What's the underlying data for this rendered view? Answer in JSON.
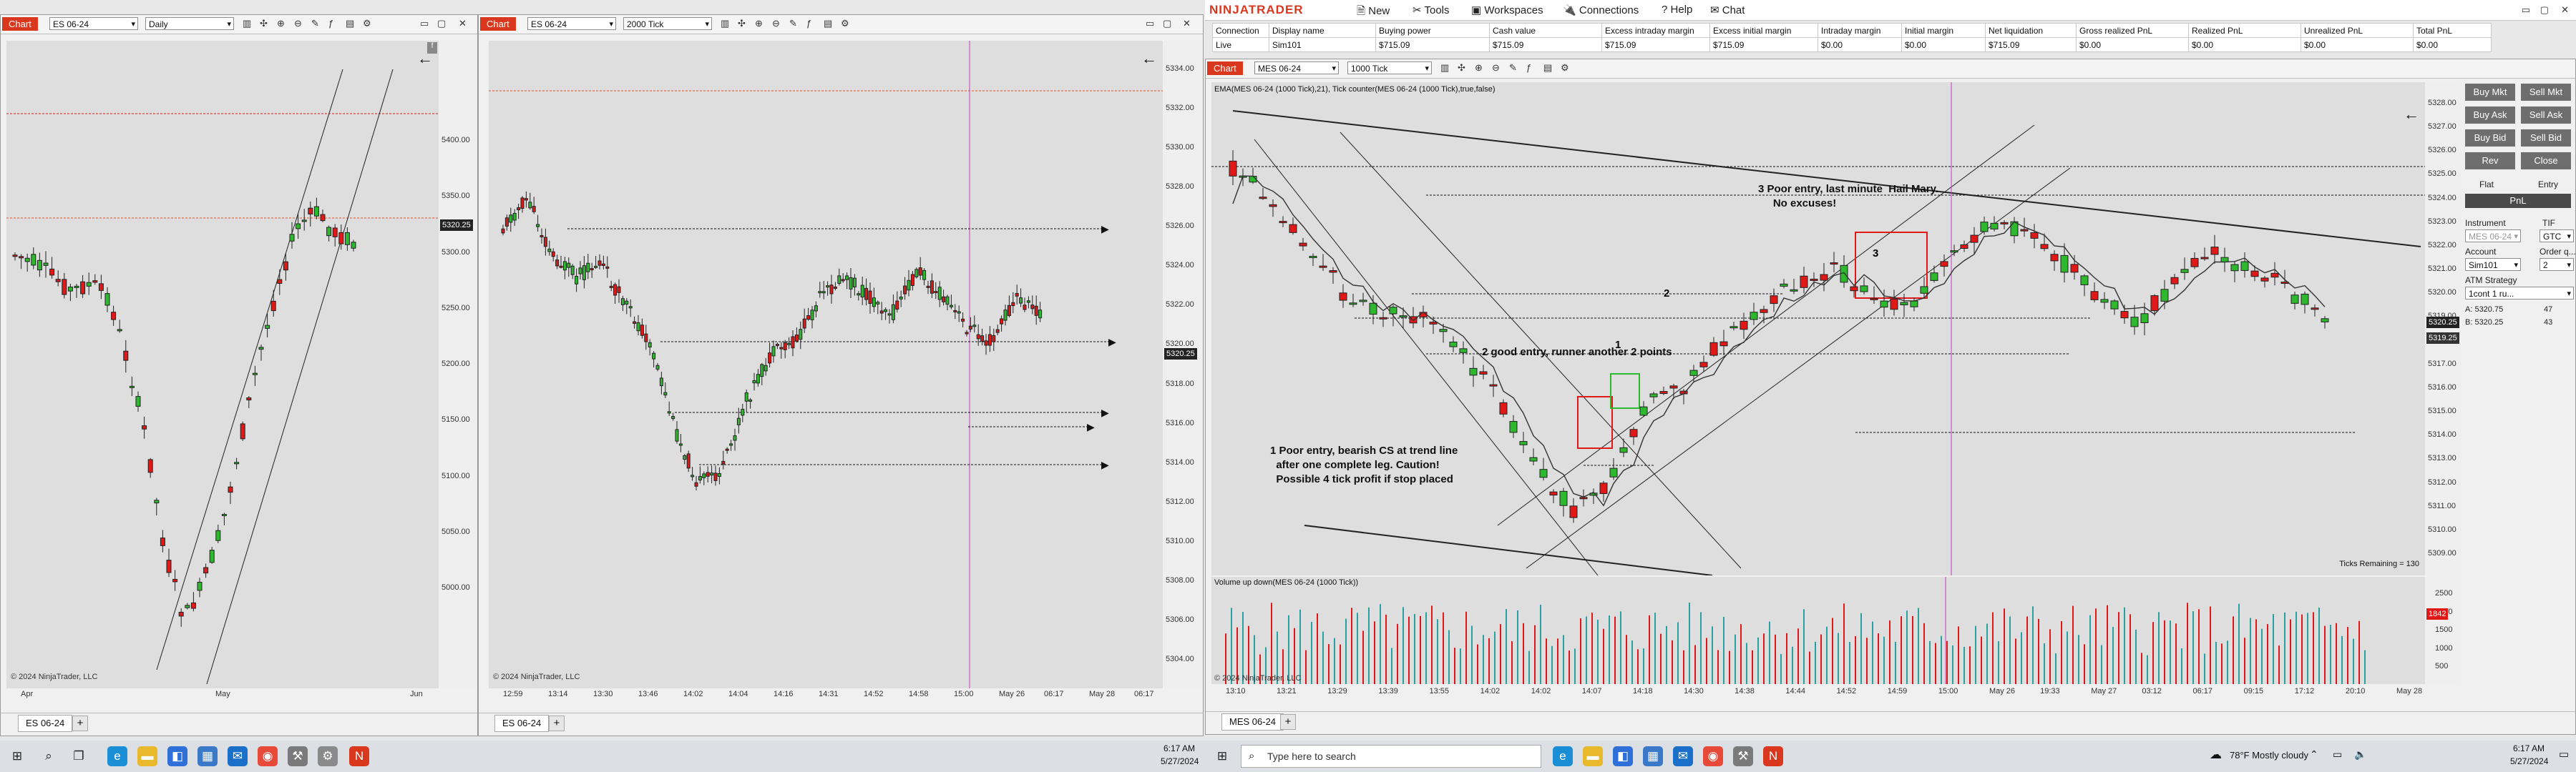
{
  "chart1": {
    "tag": "Chart",
    "instrument": "ES 06-24",
    "interval": "Daily",
    "price_labels": [
      "5400.00",
      "5350.00",
      "5300.00",
      "5250.00",
      "5200.00",
      "5150.00",
      "5100.00",
      "5050.00",
      "5000.00"
    ],
    "current_price": "5320.25",
    "x_labels": [
      "Apr",
      "May",
      "Jun"
    ],
    "copyright": "© 2024 NinjaTrader, LLC",
    "tab": "ES 06-24"
  },
  "chart2": {
    "tag": "Chart",
    "instrument": "ES 06-24",
    "interval": "2000 Tick",
    "price_labels": [
      "5334.00",
      "5332.00",
      "5330.00",
      "5328.00",
      "5326.00",
      "5324.00",
      "5322.00",
      "5320.00",
      "5318.00",
      "5316.00",
      "5314.00",
      "5312.00",
      "5310.00",
      "5308.00",
      "5306.00",
      "5304.00"
    ],
    "current_price": "5320.25",
    "x_labels": [
      "12:59",
      "13:14",
      "13:30",
      "13:46",
      "14:02",
      "14:04",
      "14:16",
      "14:31",
      "14:52",
      "14:58",
      "15:00",
      "May 26",
      "06:17",
      "May 28",
      "06:17"
    ],
    "copyright": "© 2024 NinjaTrader, LLC",
    "tab": "ES 06-24"
  },
  "nt": {
    "logo": "NINJATRADER",
    "menu": [
      "New",
      "Tools",
      "Workspaces",
      "Connections",
      "Help",
      "Chat"
    ],
    "accounts_header": [
      "Connection",
      "Display name",
      "Buying power",
      "Cash value",
      "Excess intraday margin",
      "Excess initial margin",
      "Intraday margin",
      "Initial margin",
      "Net liquidation",
      "Gross realized PnL",
      "Realized PnL",
      "Unrealized PnL",
      "Total PnL"
    ],
    "accounts_row": [
      "Live",
      "Sim101",
      "$715.09",
      "$715.09",
      "$715.09",
      "$715.09",
      "$0.00",
      "$0.00",
      "$715.09",
      "$0.00",
      "$0.00",
      "$0.00",
      "$0.00"
    ]
  },
  "chart3": {
    "tag": "Chart",
    "instrument": "MES 06-24",
    "interval": "1000 Tick",
    "indicator_label": "EMA(MES 06-24 (1000 Tick),21), Tick counter(MES 06-24 (1000 Tick),true,false)",
    "price_labels": [
      "5328.00",
      "5327.00",
      "5326.00",
      "5325.00",
      "5324.00",
      "5323.00",
      "5322.00",
      "5321.00",
      "5320.00",
      "5319.00",
      "5318.00",
      "5317.00",
      "5316.00",
      "5315.00",
      "5314.00",
      "5313.00",
      "5312.00",
      "5311.00",
      "5310.00",
      "5309.00"
    ],
    "current_price": "5320.25",
    "price_tag2": "5319.25",
    "ticks_remaining": "Ticks Remaining = 130",
    "volume_label": "Volume up down(MES 06-24 (1000 Tick))",
    "volume_labels": [
      "2500",
      "2000",
      "1500",
      "1000",
      "500"
    ],
    "volume_current": "1842",
    "x_labels": [
      "13:10",
      "13:21",
      "13:29",
      "13:39",
      "13:55",
      "14:02",
      "14:02",
      "14:07",
      "14:18",
      "14:30",
      "14:38",
      "14:44",
      "14:52",
      "14:59",
      "15:00",
      "May 26",
      "19:33",
      "May 27",
      "03:12",
      "06:17",
      "09:15",
      "17:12",
      "20:10",
      "May 28"
    ],
    "copyright": "© 2024 NinjaTrader, LLC",
    "tab": "MES 06-24",
    "note1": "1 Poor entry, bearish CS at trend line\n  after one complete leg. Caution!\n  Possible 4 tick profit if stop placed",
    "note2": "2 good entry, runner another 2 points",
    "note3": "3 Poor entry, last minute  Hail Mary.\n     No excuses!",
    "box_labels": [
      "1",
      "2",
      "3"
    ]
  },
  "order_panel": {
    "buttons": [
      "Buy Mkt",
      "Sell Mkt",
      "Buy Ask",
      "Sell Ask",
      "Buy Bid",
      "Sell Bid",
      "Rev",
      "Close"
    ],
    "flat": "Flat",
    "entry": "Entry",
    "pnl": "PnL",
    "instrument_label": "Instrument",
    "instrument": "MES 06-24",
    "tif_label": "TIF",
    "tif": "GTC",
    "account_label": "Account",
    "account": "Sim101",
    "order_qty_label": "Order q...",
    "order_qty": "2",
    "atm_label": "ATM Strategy",
    "atm_value": "1cont 1 ru...",
    "ask": "A:  5320.75",
    "ask_size": "47",
    "bid": "B:  5320.25",
    "bid_size": "43"
  },
  "taskbar_left": {
    "time": "6:17 AM",
    "date": "5/27/2024"
  },
  "taskbar_right": {
    "search_placeholder": "Type here to search",
    "weather": "78°F  Mostly cloudy",
    "time": "6:17 AM",
    "date": "5/27/2024"
  },
  "colors": {
    "up": "#2db82d",
    "down": "#e01818",
    "accent": "#d9381e"
  }
}
